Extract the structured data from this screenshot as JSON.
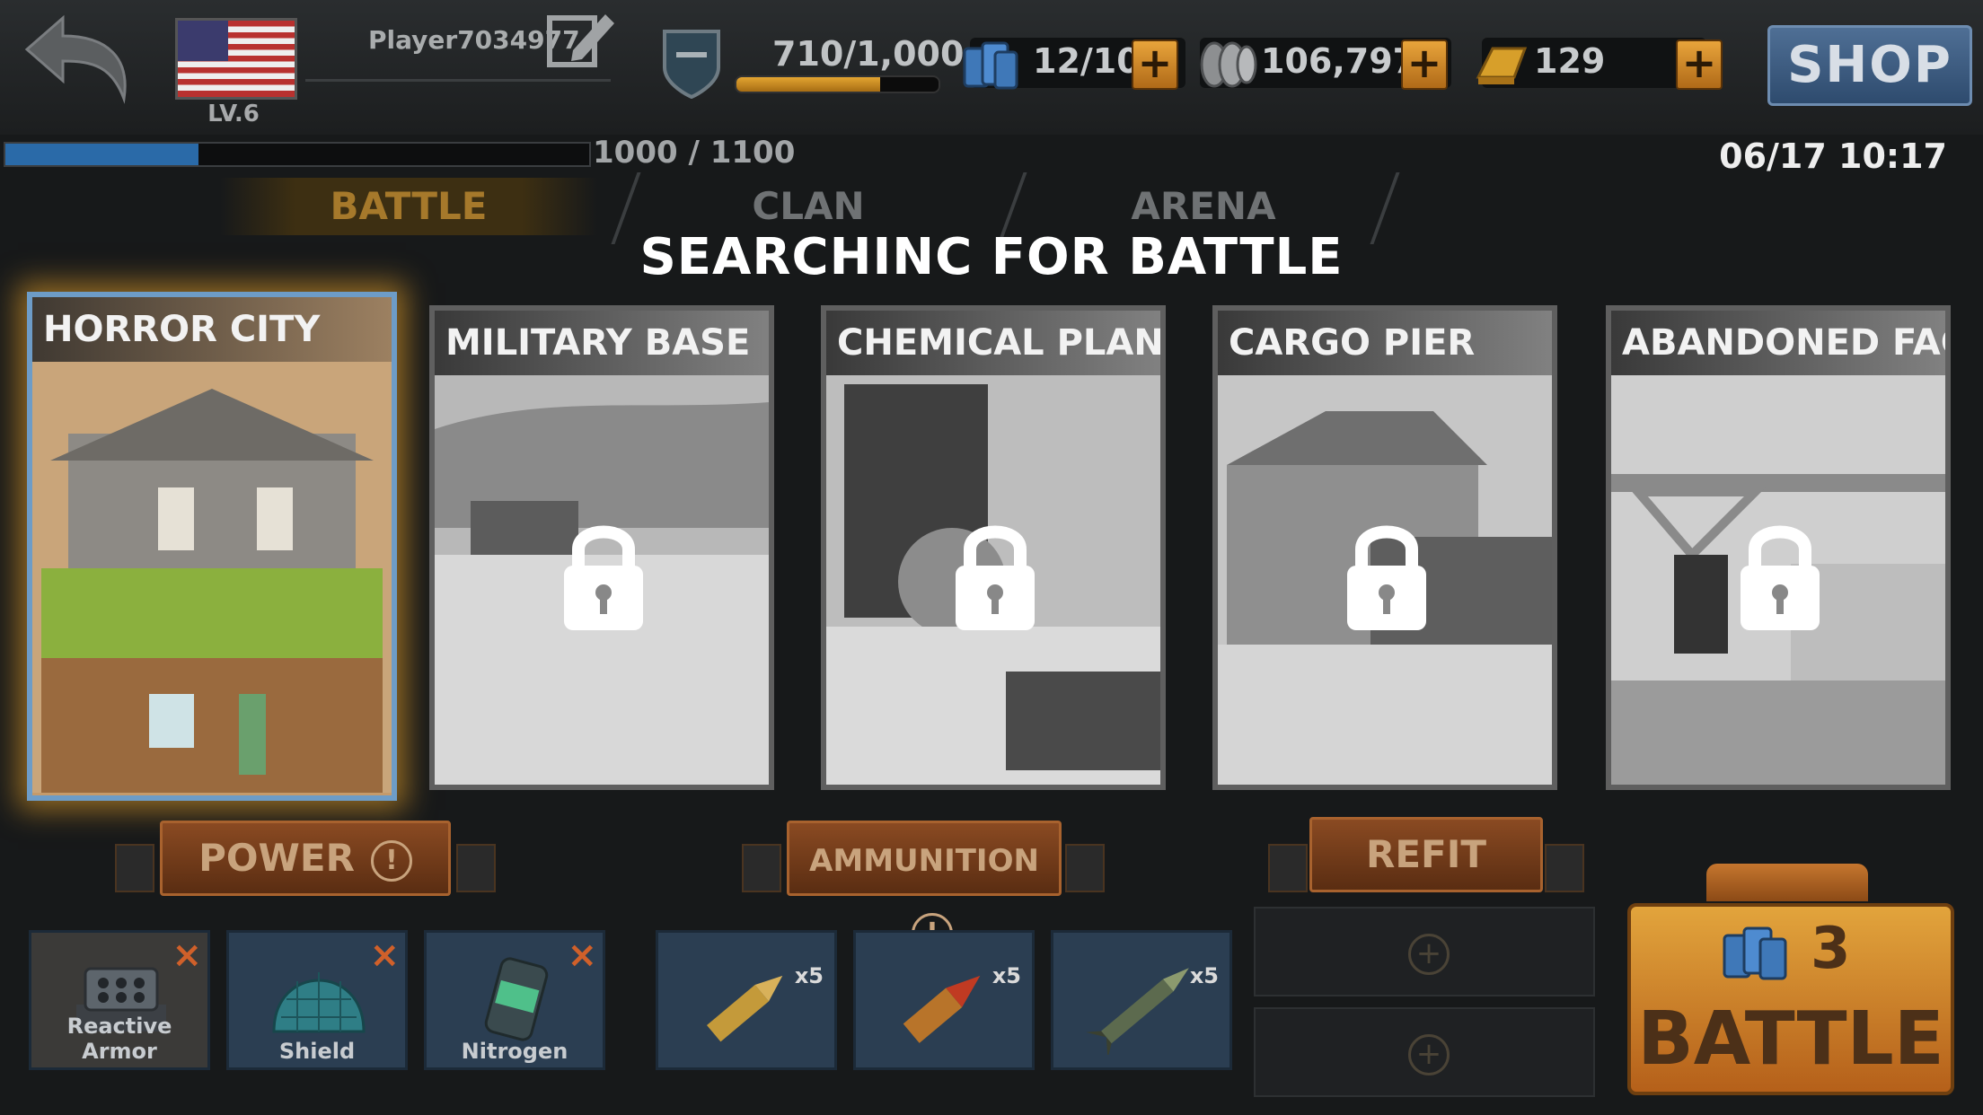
{
  "header": {
    "player_name": "Player7034977",
    "level": "LV.6",
    "xp": "710/1,000",
    "xp_fraction": 0.71,
    "fuel": "12/10",
    "coins": "106,797",
    "gold": "129",
    "shop_label": "SHOP",
    "rank_progress": "1000 / 1100",
    "rank_fraction": 0.33,
    "datetime": "06/17 10:17"
  },
  "tabs": [
    {
      "label": "BATTLE",
      "active": true
    },
    {
      "label": "CLAN",
      "active": false
    },
    {
      "label": "ARENA",
      "active": false
    }
  ],
  "status_text": "SEARCHINC FOR BATTLE",
  "maps": [
    {
      "title": "HORROR CITY",
      "locked": false,
      "selected": true
    },
    {
      "title": "MILITARY BASE",
      "locked": true
    },
    {
      "title": "CHEMICAL PLANT",
      "locked": true
    },
    {
      "title": "CARGO PIER",
      "locked": true
    },
    {
      "title": "ABANDONED FACTORY",
      "locked": true
    }
  ],
  "actions": {
    "power": "POWER",
    "ammunition": "AMMUNITION",
    "refit": "REFIT",
    "alert_glyph": "!"
  },
  "items": [
    {
      "label": "Reactive Armor",
      "icon": "reactive-armor-icon"
    },
    {
      "label": "Shield",
      "icon": "shield-dome-icon"
    },
    {
      "label": "Nitrogen",
      "icon": "nitrogen-canister-icon"
    }
  ],
  "ammo": [
    {
      "qty": "x5",
      "icon": "bullet-icon"
    },
    {
      "qty": "x5",
      "icon": "shell-icon"
    },
    {
      "qty": "x5",
      "icon": "rocket-icon"
    }
  ],
  "empty_slot_glyph": "+",
  "plus_glyph": "+",
  "battle": {
    "label": "BATTLE",
    "cost": "3"
  },
  "colors": {
    "accent": "#e2a43c",
    "selected_border": "#6d9cc7",
    "action_button": "#8a4a22"
  }
}
